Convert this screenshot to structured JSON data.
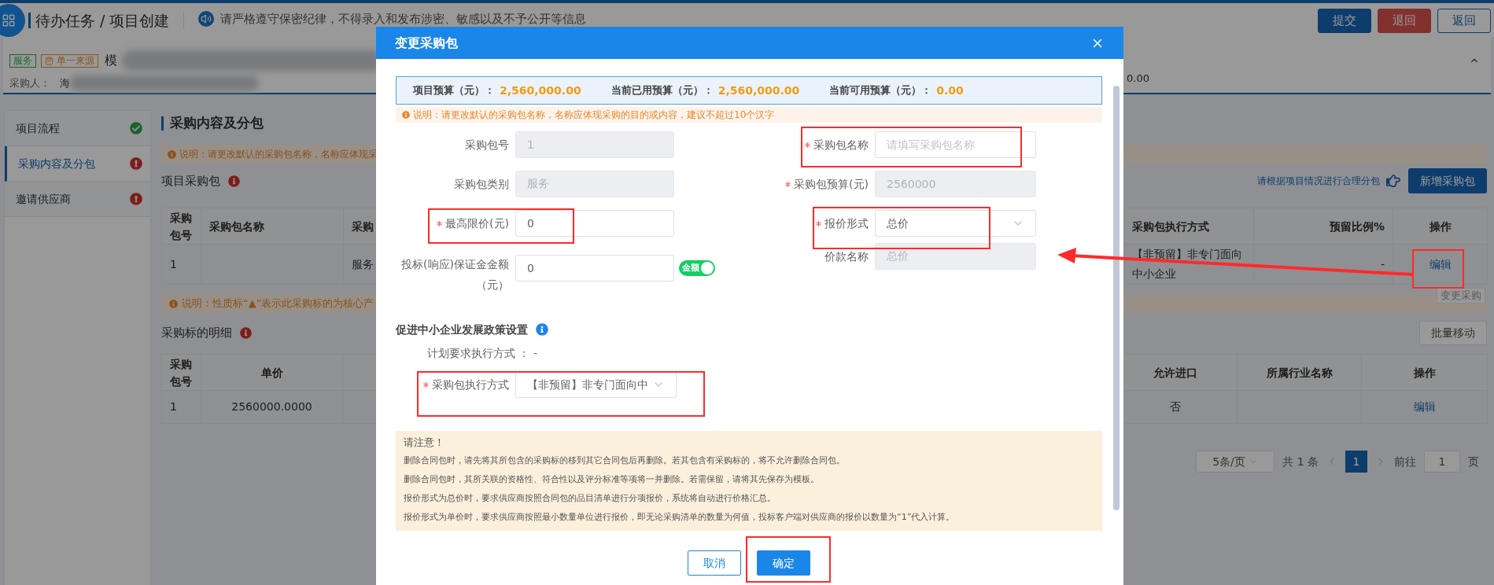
{
  "header": {
    "title": "待办任务 / 项目创建",
    "notice": "请严格遵守保密纪律，不得录入和发布涉密、敏感以及不予公开等信息",
    "buttons": [
      {
        "label": "提交",
        "kind": "primary"
      },
      {
        "label": "退回",
        "kind": "danger"
      },
      {
        "label": "返回",
        "kind": "outline"
      }
    ]
  },
  "project": {
    "tags": [
      {
        "label": "服务",
        "kind": "category"
      },
      {
        "label": "单一来源",
        "kind": "method"
      }
    ],
    "name": "模",
    "buyer_label": "采购人：",
    "buyer": "海",
    "budget_tail": "0.00"
  },
  "sidebar": {
    "items": [
      {
        "label": "项目流程",
        "kind": "done",
        "selected": false
      },
      {
        "label": "采购内容及分包",
        "kind": "error",
        "selected": true
      },
      {
        "label": "邀请供应商",
        "kind": "error",
        "selected": false
      }
    ]
  },
  "content": {
    "title": "采购内容及分包",
    "notice1": "说明：请更改默认的采购包名称，名称应体现采",
    "packages_title": "项目采购包",
    "split_hint": "请根据项目情况进行合理分包",
    "add_button": "新增采购包",
    "table1": {
      "columns": [
        {
          "label": "采购包号",
          "kind": "text"
        },
        {
          "label": "采购包名称"
        },
        {
          "label": "采购",
          "kind": "text"
        },
        {
          "label": "采购包执行方式",
          "kind": "text"
        },
        {
          "label": "预留比例%",
          "kind": "text"
        },
        {
          "label": "操作",
          "kind": "action"
        }
      ],
      "rows": [
        [
          "1",
          null,
          "服务",
          "【非预留】非专门面向中小企业",
          "-",
          "编辑"
        ]
      ]
    },
    "tooltip": "变更采购",
    "notice2": "说明：性质标“▲”表示此采购标的为核心产",
    "items_title": "采购标的明细",
    "move_button": "批量移动",
    "table2": {
      "columns": [
        {
          "label": "采购包号",
          "kind": "text"
        },
        {
          "label": "单价",
          "kind": "text"
        },
        {},
        {
          "label": "允许进口",
          "kind": "text"
        },
        {
          "label": "所属行业名称"
        },
        {
          "label": "操作",
          "kind": "action"
        }
      ],
      "rows": [
        [
          "1",
          "2560000.0000",
          null,
          "否",
          null,
          "编辑"
        ]
      ]
    },
    "pagination": {
      "page_size": "5条/页",
      "total": "共 1 条",
      "pages": [
        {
          "label": "1",
          "selected": true
        }
      ],
      "goto_label": "前往",
      "goto_value": "1",
      "goto_suffix": "页"
    }
  },
  "modal": {
    "title": "变更采购包",
    "budget": [
      {
        "label": "项目预算（元）：",
        "value": "2,560,000.00"
      },
      {
        "label": "当前已用预算（元）：",
        "value": "2,560,000.00"
      },
      {
        "label": "当前可用预算（元）：",
        "value": "0.00"
      }
    ],
    "notice": "说明：请更改默认的采购包名称，名称应体现采购的目的或内容，建议不超过10个汉字",
    "rows": [
      [
        {
          "label": "采购包号",
          "required": false,
          "kind": "input",
          "value": "1",
          "disabled": true
        },
        {
          "label": "采购包名称",
          "required": true,
          "kind": "input",
          "placeholder": "请填写采购包名称",
          "disabled": false
        }
      ],
      [
        {
          "label": "采购包类别",
          "required": false,
          "kind": "input",
          "value": "服务",
          "disabled": true
        },
        {
          "label": "采购包预算(元)",
          "required": true,
          "kind": "input",
          "value": "2560000",
          "disabled": true
        }
      ],
      [
        {
          "label": "最高限价(元)",
          "required": true,
          "kind": "input",
          "value": "0",
          "disabled": false
        },
        {
          "label": "报价形式",
          "required": true,
          "kind": "select",
          "value": "总价",
          "disabled": false
        }
      ],
      [
        {
          "label": "投标(响应)保证金金额（元）",
          "required": false,
          "kind": "input",
          "value": "0",
          "disabled": false,
          "toggle": {
            "label": "金额",
            "on": true
          }
        },
        {
          "label": "价款名称",
          "required": false,
          "kind": "input",
          "value": "总价",
          "disabled": true
        }
      ]
    ],
    "policy_title": "促进中小企业发展政策设置",
    "plan": "计划要求执行方式 ： -",
    "exec": {
      "label": "采购包执行方式",
      "required": true,
      "kind": "select",
      "value": "【非预留】非专门面向中",
      "disabled": false
    },
    "notes": {
      "title": "请注意！",
      "lines": [
        "删除合同包时，请先将其所包含的采购标的移到其它合同包后再删除。若其包含有采购标的，将不允许删除合同包。",
        "删除合同包时，其所关联的资格性、符合性以及评分标准等项将一并删除。若需保留，请将其先保存为模板。",
        "报价形式为总价时，要求供应商按照合同包的品目清单进行分项报价，系统将自动进行价格汇总。",
        "报价形式为单价时，要求供应商按照最小数量单位进行报价，即无论采购清单的数量为何值，投标客户端对供应商的报价以数量为“1”代入计算。"
      ]
    },
    "buttons": [
      {
        "label": "取消",
        "kind": "outline"
      },
      {
        "label": "确定",
        "kind": "primary"
      }
    ]
  }
}
